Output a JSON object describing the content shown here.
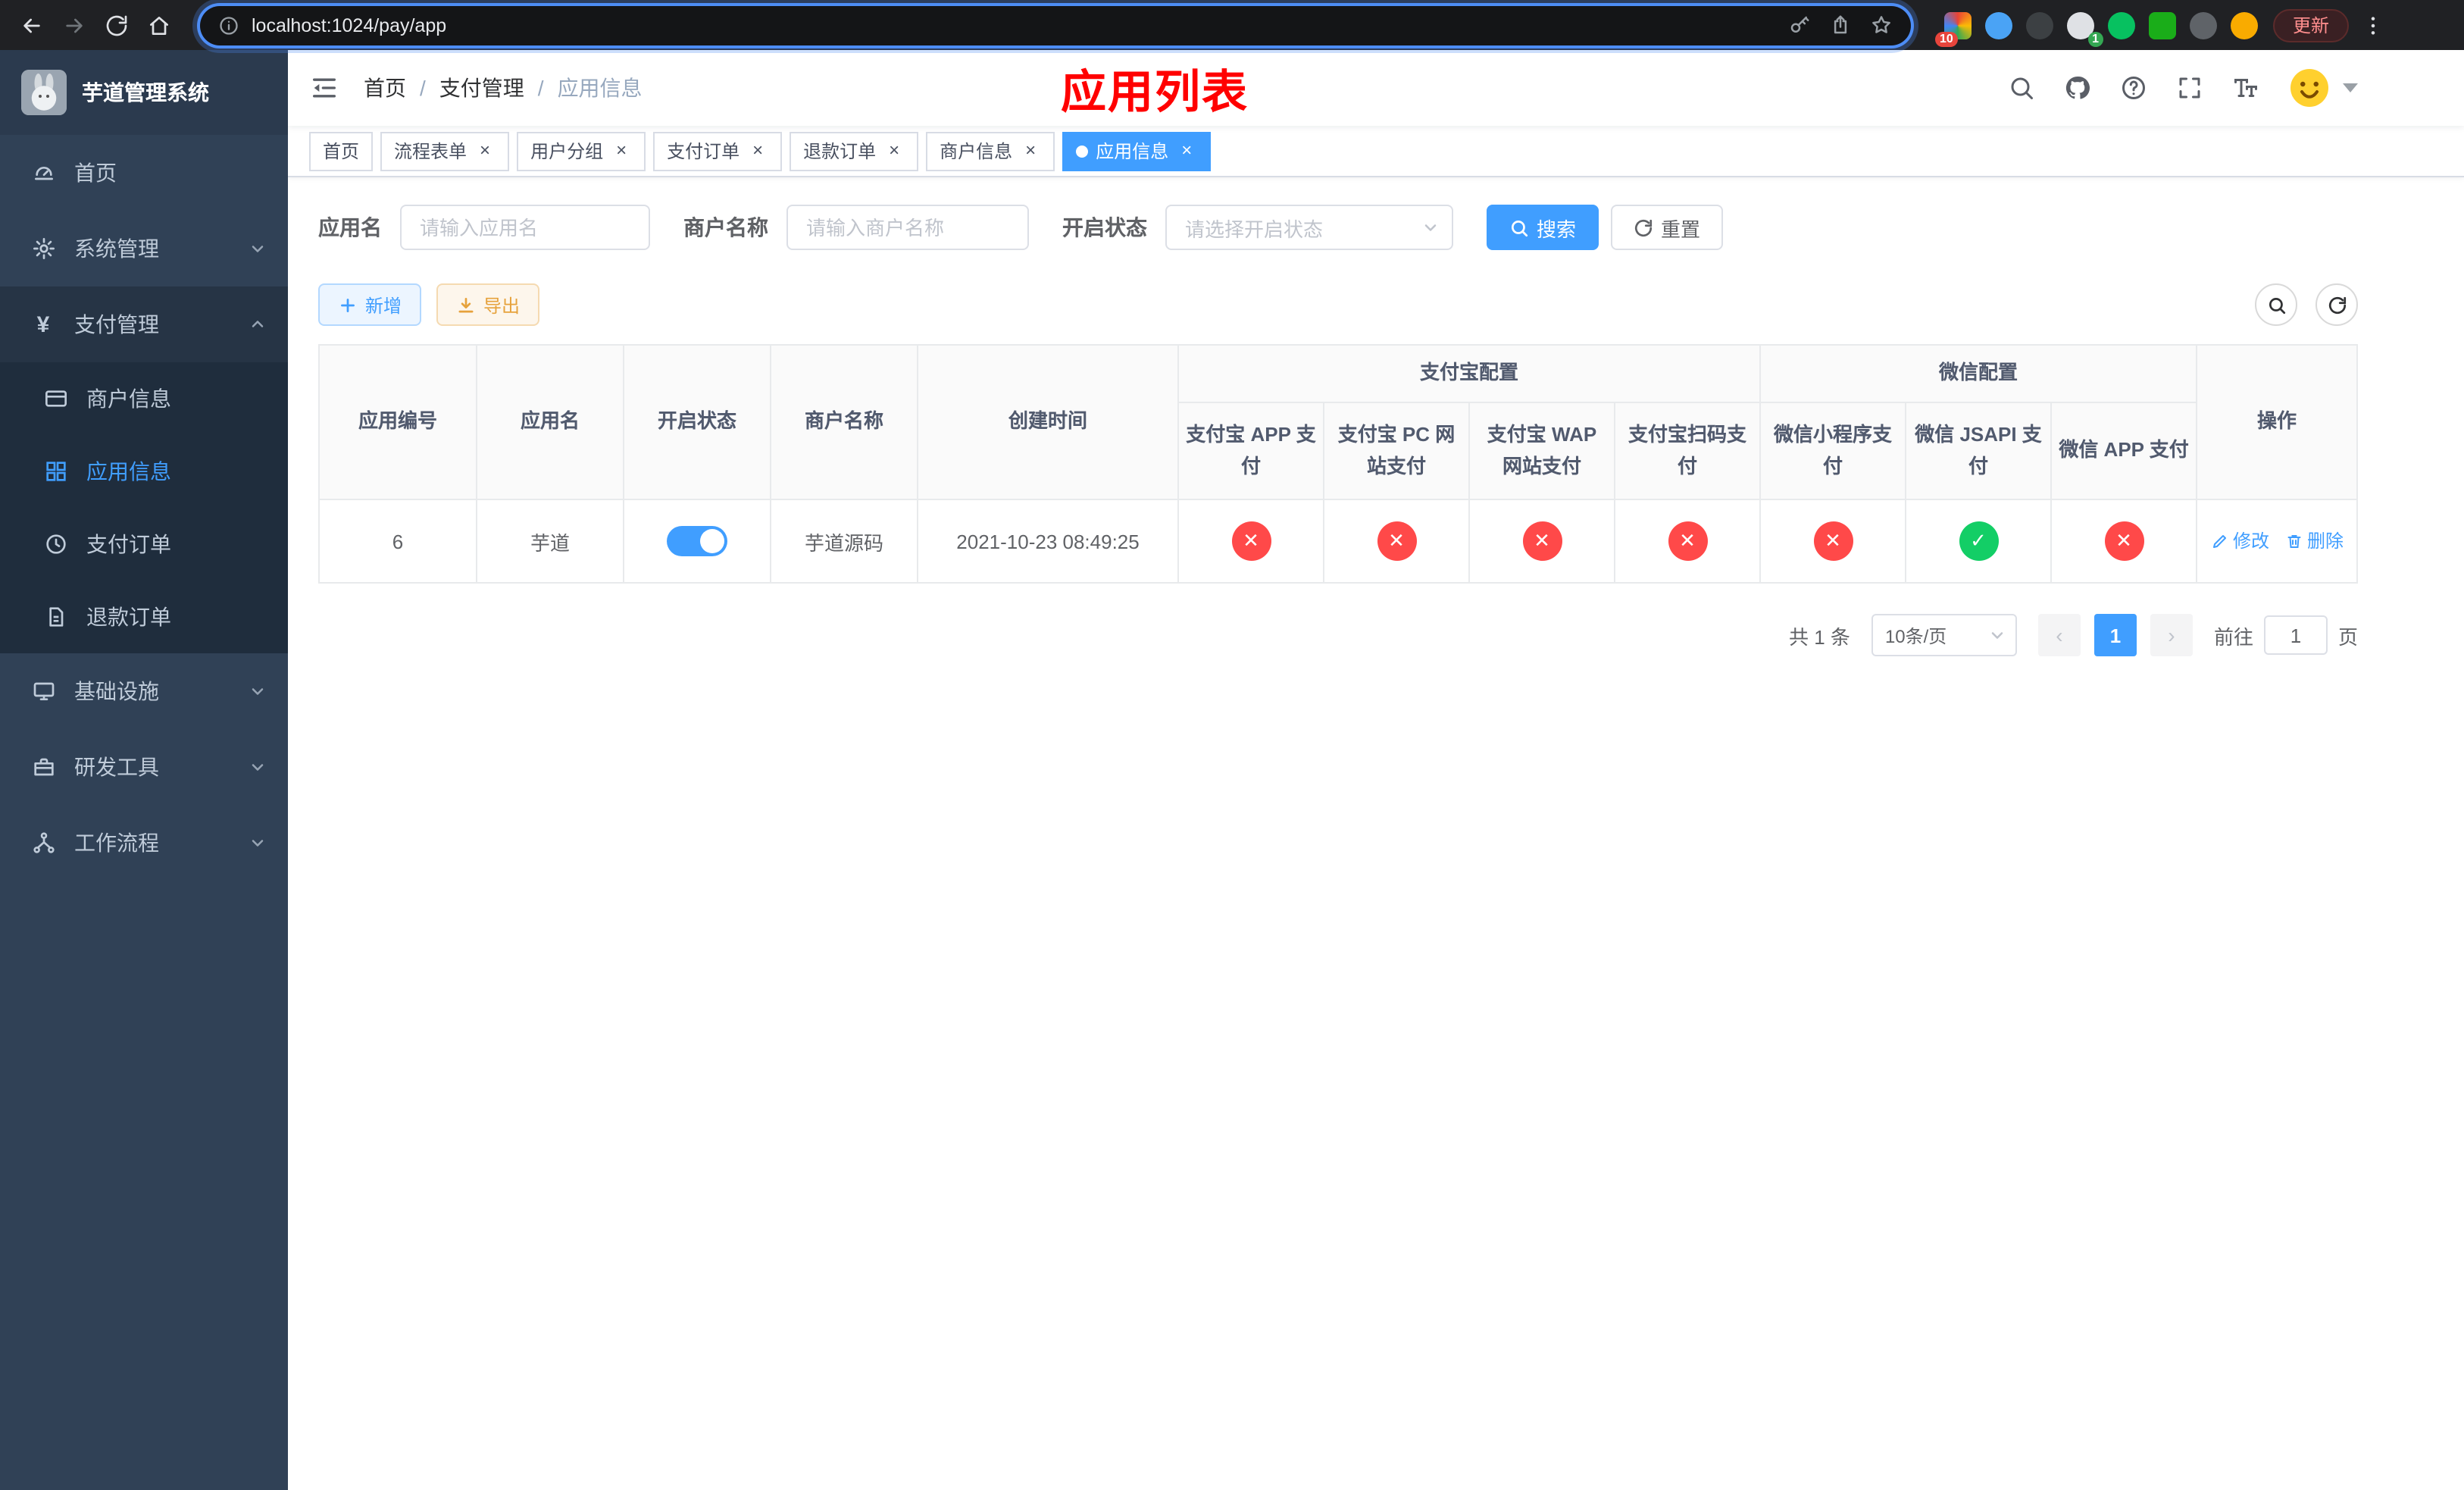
{
  "browser": {
    "url": "localhost:1024/pay/app",
    "update_button": "更新",
    "extension_badge_red": "10",
    "extension_badge_green": "1"
  },
  "icons": {
    "close": "×",
    "check": "✓",
    "cross": "✕",
    "yen": "¥"
  },
  "sidebar": {
    "app_title": "芋道管理系统",
    "menu": {
      "home": "首页",
      "system": "系统管理",
      "payment": "支付管理",
      "infra": "基础设施",
      "devtools": "研发工具",
      "workflow": "工作流程"
    },
    "payment_children": {
      "merchant": "商户信息",
      "app": "应用信息",
      "order": "支付订单",
      "refund": "退款订单"
    }
  },
  "header": {
    "breadcrumb": [
      "首页",
      "支付管理",
      "应用信息"
    ],
    "separator": "/",
    "page_title": "应用列表"
  },
  "tabs": [
    {
      "label": "首页"
    },
    {
      "label": "流程表单"
    },
    {
      "label": "用户分组"
    },
    {
      "label": "支付订单"
    },
    {
      "label": "退款订单"
    },
    {
      "label": "商户信息"
    },
    {
      "label": "应用信息"
    }
  ],
  "filters": {
    "app_name_label": "应用名",
    "app_name_placeholder": "请输入应用名",
    "merchant_label": "商户名称",
    "merchant_placeholder": "请输入商户名称",
    "status_label": "开启状态",
    "status_placeholder": "请选择开启状态",
    "search_button": "搜索",
    "reset_button": "重置"
  },
  "toolbar": {
    "add_button": "新增",
    "export_button": "导出"
  },
  "table": {
    "headers": {
      "app_id": "应用编号",
      "app_name": "应用名",
      "status": "开启状态",
      "merchant_name": "商户名称",
      "create_time": "创建时间",
      "alipay_group": "支付宝配置",
      "wechat_group": "微信配置",
      "alipay_app": "支付宝 APP 支付",
      "alipay_pc": "支付宝 PC 网站支付",
      "alipay_wap": "支付宝 WAP 网站支付",
      "alipay_qr": "支付宝扫码支付",
      "wechat_lite": "微信小程序支付",
      "wechat_jsapi": "微信 JSAPI 支付",
      "wechat_app": "微信 APP 支付",
      "actions": "操作"
    },
    "actions": {
      "edit": "修改",
      "delete": "删除"
    },
    "rows": [
      {
        "app_id": "6",
        "app_name": "芋道",
        "status_on": true,
        "merchant_name": "芋道源码",
        "create_time": "2021-10-23 08:49:25",
        "alipay_app": "disabled",
        "alipay_pc": "disabled",
        "alipay_wap": "disabled",
        "alipay_qr": "disabled",
        "wechat_lite": "disabled",
        "wechat_jsapi": "enabled",
        "wechat_app": "disabled"
      }
    ]
  },
  "pagination": {
    "total_text": "共 1 条",
    "page_size": "10条/页",
    "current_page": "1",
    "goto_prefix": "前往",
    "goto_value": "1",
    "goto_suffix": "页"
  },
  "colors": {
    "primary": "#409eff",
    "danger": "#ff4949",
    "success": "#13ce66",
    "warning": "#e6a23c",
    "title": "#ff0000"
  }
}
